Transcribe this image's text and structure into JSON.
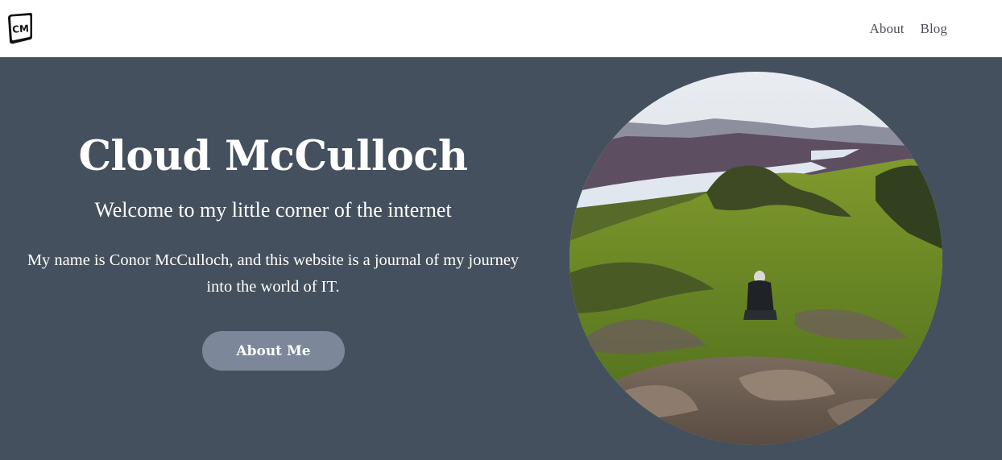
{
  "header": {
    "logo_text": "CM",
    "nav": [
      {
        "label": "About"
      },
      {
        "label": "Blog"
      }
    ]
  },
  "hero": {
    "title": "Cloud McCulloch",
    "subtitle": "Welcome to my little corner of the internet",
    "body": "My name is Conor McCulloch, and this website is a journal of my journey into the world of IT.",
    "button_label": "About Me"
  },
  "colors": {
    "hero_background": "#45505e",
    "button_background": "#7c8899",
    "nav_text": "#4a4f58"
  }
}
